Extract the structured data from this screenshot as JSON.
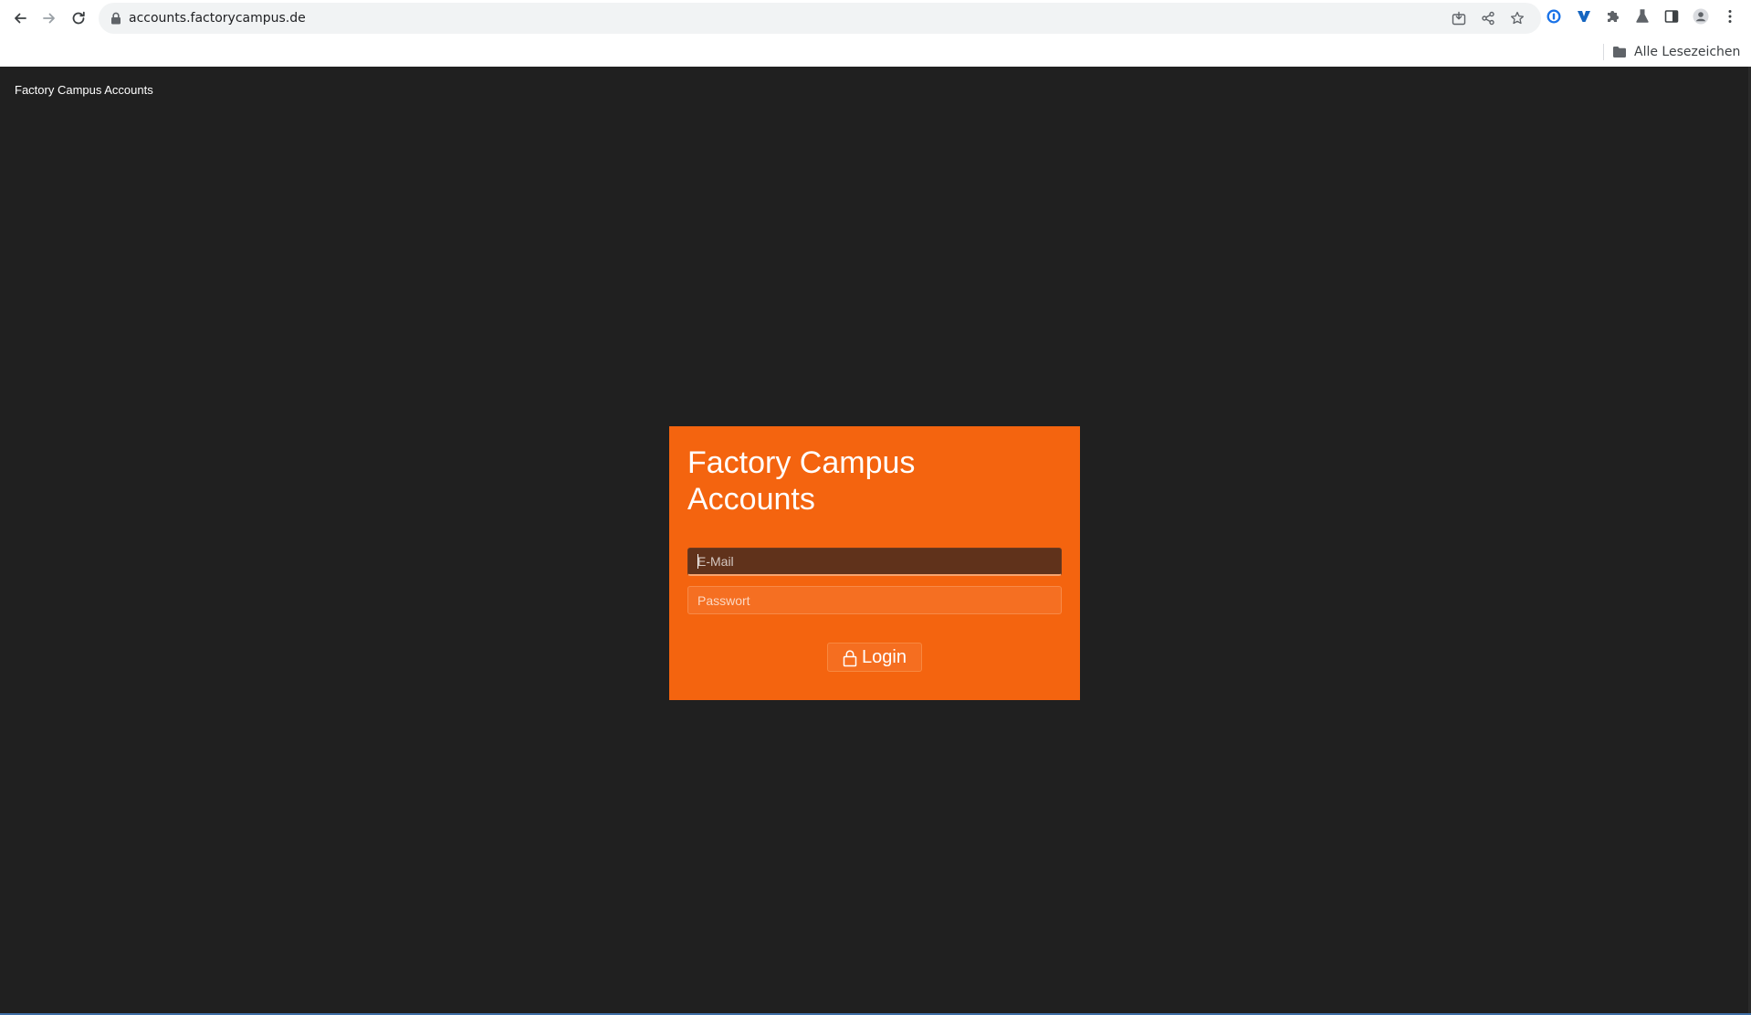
{
  "browser": {
    "url": "accounts.factorycampus.de",
    "bookmarks_folder": "Alle Lesezeichen"
  },
  "page": {
    "brand": "Factory Campus Accounts",
    "card": {
      "title": "Factory Campus Accounts",
      "email_placeholder": "E-Mail",
      "password_placeholder": "Passwort",
      "login_label": "Login"
    }
  },
  "colors": {
    "page_background": "#202020",
    "card_accent": "#f4640f",
    "email_field_focused": "#60321b"
  },
  "icons": {
    "lock_button": "padlock-icon",
    "back": "arrow-left-icon",
    "forward": "arrow-right-icon",
    "reload": "reload-icon"
  }
}
